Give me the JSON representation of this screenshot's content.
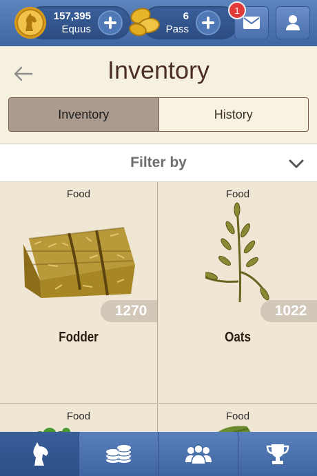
{
  "topbar": {
    "equus": {
      "amount": "157,395",
      "label": "Equus",
      "icon": "horse-coin-icon"
    },
    "pass": {
      "amount": "6",
      "label": "Pass",
      "icon": "pass-coins-icon"
    },
    "mail": {
      "badge": "1",
      "icon": "mail-icon"
    },
    "profile": {
      "icon": "profile-icon"
    }
  },
  "header": {
    "title": "Inventory",
    "tabs": [
      {
        "label": "Inventory",
        "active": true
      },
      {
        "label": "History",
        "active": false
      }
    ]
  },
  "filter": {
    "label": "Filter by"
  },
  "items": [
    {
      "category": "Food",
      "name": "Fodder",
      "quantity": "1270",
      "icon": "hay-bale-icon"
    },
    {
      "category": "Food",
      "name": "Oats",
      "quantity": "1022",
      "icon": "oats-icon"
    },
    {
      "category": "Food",
      "name": "",
      "quantity": "",
      "icon": "green-plant-icon"
    },
    {
      "category": "Food",
      "name": "",
      "quantity": "",
      "icon": "leaf-icon"
    }
  ],
  "bottomnav": [
    {
      "name": "horse",
      "icon": "horse-head-icon",
      "active": true
    },
    {
      "name": "coins",
      "icon": "coins-icon",
      "active": false
    },
    {
      "name": "club",
      "icon": "group-icon",
      "active": false
    },
    {
      "name": "trophy",
      "icon": "trophy-icon",
      "active": false
    }
  ],
  "colors": {
    "accent": "#4a70ad",
    "title": "#4a2e26",
    "badge": "#e23a3a",
    "card": "#efe6d3"
  }
}
